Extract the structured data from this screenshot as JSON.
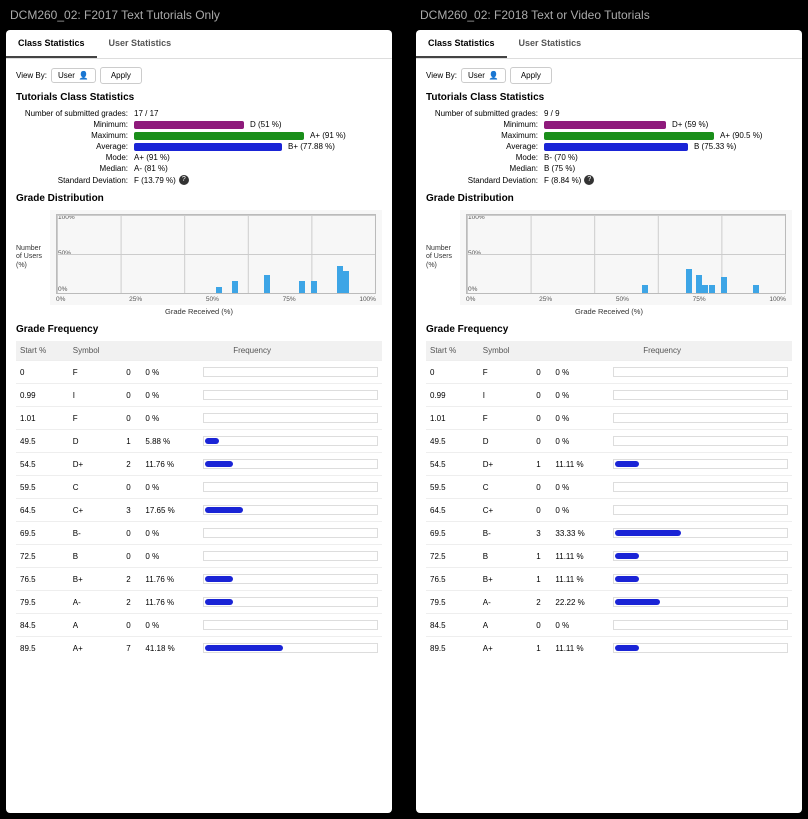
{
  "ui": {
    "tabs": {
      "class": "Class Statistics",
      "user": "User Statistics"
    },
    "viewby": "View By:",
    "selector": "User",
    "apply": "Apply",
    "sect_cls": "Tutorials Class Statistics",
    "sect_dist": "Grade Distribution",
    "sect_freq": "Grade Frequency",
    "submitted_lbl": "Number of submitted grades:",
    "lbl_min": "Minimum:",
    "lbl_max": "Maximum:",
    "lbl_avg": "Average:",
    "lbl_mode": "Mode:",
    "lbl_median": "Median:",
    "lbl_sd": "Standard Deviation:",
    "help": "?",
    "ylabel": "Number of Users (%)",
    "xlabel": "Grade Received (%)",
    "th_start": "Start %",
    "th_sym": "Symbol",
    "th_freq": "Frequency",
    "xticks": [
      "0%",
      "25%",
      "50%",
      "75%",
      "100%"
    ]
  },
  "panels": [
    {
      "title": "DCM260_02: F2017 Text Tutorials Only",
      "submitted": "17 / 17",
      "min_pct": 51,
      "min_grade": "D (51 %)",
      "max_pct": 91,
      "max_grade": "A+ (91 %)",
      "avg_pct": 77.88,
      "avg_grade": "B+ (77.88 %)",
      "mode": "A+ (91 %)",
      "median": "A- (81 %)",
      "sd": "F (13.79 %)",
      "yticks": [
        "100%",
        "50%",
        "0%"
      ],
      "bars": [
        {
          "pos": 50,
          "h": 8
        },
        {
          "pos": 55,
          "h": 15
        },
        {
          "pos": 65,
          "h": 22
        },
        {
          "pos": 76,
          "h": 15
        },
        {
          "pos": 80,
          "h": 15
        },
        {
          "pos": 88,
          "h": 34
        },
        {
          "pos": 90,
          "h": 28
        }
      ],
      "rows": [
        {
          "start": "0",
          "sym": "F",
          "n": "0",
          "pct": "0 %",
          "w": 0
        },
        {
          "start": "0.99",
          "sym": "I",
          "n": "0",
          "pct": "0 %",
          "w": 0
        },
        {
          "start": "1.01",
          "sym": "F",
          "n": "0",
          "pct": "0 %",
          "w": 0
        },
        {
          "start": "49.5",
          "sym": "D",
          "n": "1",
          "pct": "5.88 %",
          "w": 8
        },
        {
          "start": "54.5",
          "sym": "D+",
          "n": "2",
          "pct": "11.76 %",
          "w": 16
        },
        {
          "start": "59.5",
          "sym": "C",
          "n": "0",
          "pct": "0 %",
          "w": 0
        },
        {
          "start": "64.5",
          "sym": "C+",
          "n": "3",
          "pct": "17.65 %",
          "w": 22
        },
        {
          "start": "69.5",
          "sym": "B-",
          "n": "0",
          "pct": "0 %",
          "w": 0
        },
        {
          "start": "72.5",
          "sym": "B",
          "n": "0",
          "pct": "0 %",
          "w": 0
        },
        {
          "start": "76.5",
          "sym": "B+",
          "n": "2",
          "pct": "11.76 %",
          "w": 16
        },
        {
          "start": "79.5",
          "sym": "A-",
          "n": "2",
          "pct": "11.76 %",
          "w": 16
        },
        {
          "start": "84.5",
          "sym": "A",
          "n": "0",
          "pct": "0 %",
          "w": 0
        },
        {
          "start": "89.5",
          "sym": "A+",
          "n": "7",
          "pct": "41.18 %",
          "w": 45
        }
      ]
    },
    {
      "title": "DCM260_02: F2018 Text or Video Tutorials",
      "submitted": "9 / 9",
      "min_pct": 59,
      "min_grade": "D+ (59 %)",
      "max_pct": 90.5,
      "max_grade": "A+ (90.5 %)",
      "avg_pct": 75.33,
      "avg_grade": "B (75.33 %)",
      "mode": "B- (70 %)",
      "median": "B (75 %)",
      "sd": "F (8.84 %)",
      "yticks": [
        "100%",
        "50%",
        "0%"
      ],
      "bars": [
        {
          "pos": 55,
          "h": 10
        },
        {
          "pos": 69,
          "h": 30
        },
        {
          "pos": 72,
          "h": 22
        },
        {
          "pos": 74,
          "h": 10
        },
        {
          "pos": 76,
          "h": 10
        },
        {
          "pos": 80,
          "h": 20
        },
        {
          "pos": 90,
          "h": 10
        }
      ],
      "rows": [
        {
          "start": "0",
          "sym": "F",
          "n": "0",
          "pct": "0 %",
          "w": 0
        },
        {
          "start": "0.99",
          "sym": "I",
          "n": "0",
          "pct": "0 %",
          "w": 0
        },
        {
          "start": "1.01",
          "sym": "F",
          "n": "0",
          "pct": "0 %",
          "w": 0
        },
        {
          "start": "49.5",
          "sym": "D",
          "n": "0",
          "pct": "0 %",
          "w": 0
        },
        {
          "start": "54.5",
          "sym": "D+",
          "n": "1",
          "pct": "11.11 %",
          "w": 14
        },
        {
          "start": "59.5",
          "sym": "C",
          "n": "0",
          "pct": "0 %",
          "w": 0
        },
        {
          "start": "64.5",
          "sym": "C+",
          "n": "0",
          "pct": "0 %",
          "w": 0
        },
        {
          "start": "69.5",
          "sym": "B-",
          "n": "3",
          "pct": "33.33 %",
          "w": 38
        },
        {
          "start": "72.5",
          "sym": "B",
          "n": "1",
          "pct": "11.11 %",
          "w": 14
        },
        {
          "start": "76.5",
          "sym": "B+",
          "n": "1",
          "pct": "11.11 %",
          "w": 14
        },
        {
          "start": "79.5",
          "sym": "A-",
          "n": "2",
          "pct": "22.22 %",
          "w": 26
        },
        {
          "start": "84.5",
          "sym": "A",
          "n": "0",
          "pct": "0 %",
          "w": 0
        },
        {
          "start": "89.5",
          "sym": "A+",
          "n": "1",
          "pct": "11.11 %",
          "w": 14
        }
      ]
    }
  ],
  "chart_data": [
    {
      "type": "bar",
      "title": "Grade Distribution",
      "xlabel": "Grade Received (%)",
      "ylabel": "Number of Users (%)",
      "xlim": [
        0,
        100
      ],
      "ylim": [
        0,
        100
      ],
      "series": [
        {
          "name": "F2017",
          "x": [
            50,
            55,
            65,
            76,
            80,
            88,
            90
          ],
          "y": [
            8,
            15,
            22,
            15,
            15,
            34,
            28
          ]
        }
      ]
    },
    {
      "type": "bar",
      "title": "Grade Distribution",
      "xlabel": "Grade Received (%)",
      "ylabel": "Number of Users (%)",
      "xlim": [
        0,
        100
      ],
      "ylim": [
        0,
        100
      ],
      "series": [
        {
          "name": "F2018",
          "x": [
            55,
            69,
            72,
            74,
            76,
            80,
            90
          ],
          "y": [
            10,
            30,
            22,
            10,
            10,
            20,
            10
          ]
        }
      ]
    },
    {
      "type": "table",
      "title": "Tutorials Class Statistics F2017",
      "rows": [
        [
          "Minimum",
          "D (51 %)"
        ],
        [
          "Maximum",
          "A+ (91 %)"
        ],
        [
          "Average",
          "B+ (77.88 %)"
        ],
        [
          "Mode",
          "A+ (91 %)"
        ],
        [
          "Median",
          "A- (81 %)"
        ],
        [
          "Standard Deviation",
          "F (13.79 %)"
        ]
      ]
    },
    {
      "type": "table",
      "title": "Tutorials Class Statistics F2018",
      "rows": [
        [
          "Minimum",
          "D+ (59 %)"
        ],
        [
          "Maximum",
          "A+ (90.5 %)"
        ],
        [
          "Average",
          "B (75.33 %)"
        ],
        [
          "Mode",
          "B- (70 %)"
        ],
        [
          "Median",
          "B (75 %)"
        ],
        [
          "Standard Deviation",
          "F (8.84 %)"
        ]
      ]
    }
  ]
}
